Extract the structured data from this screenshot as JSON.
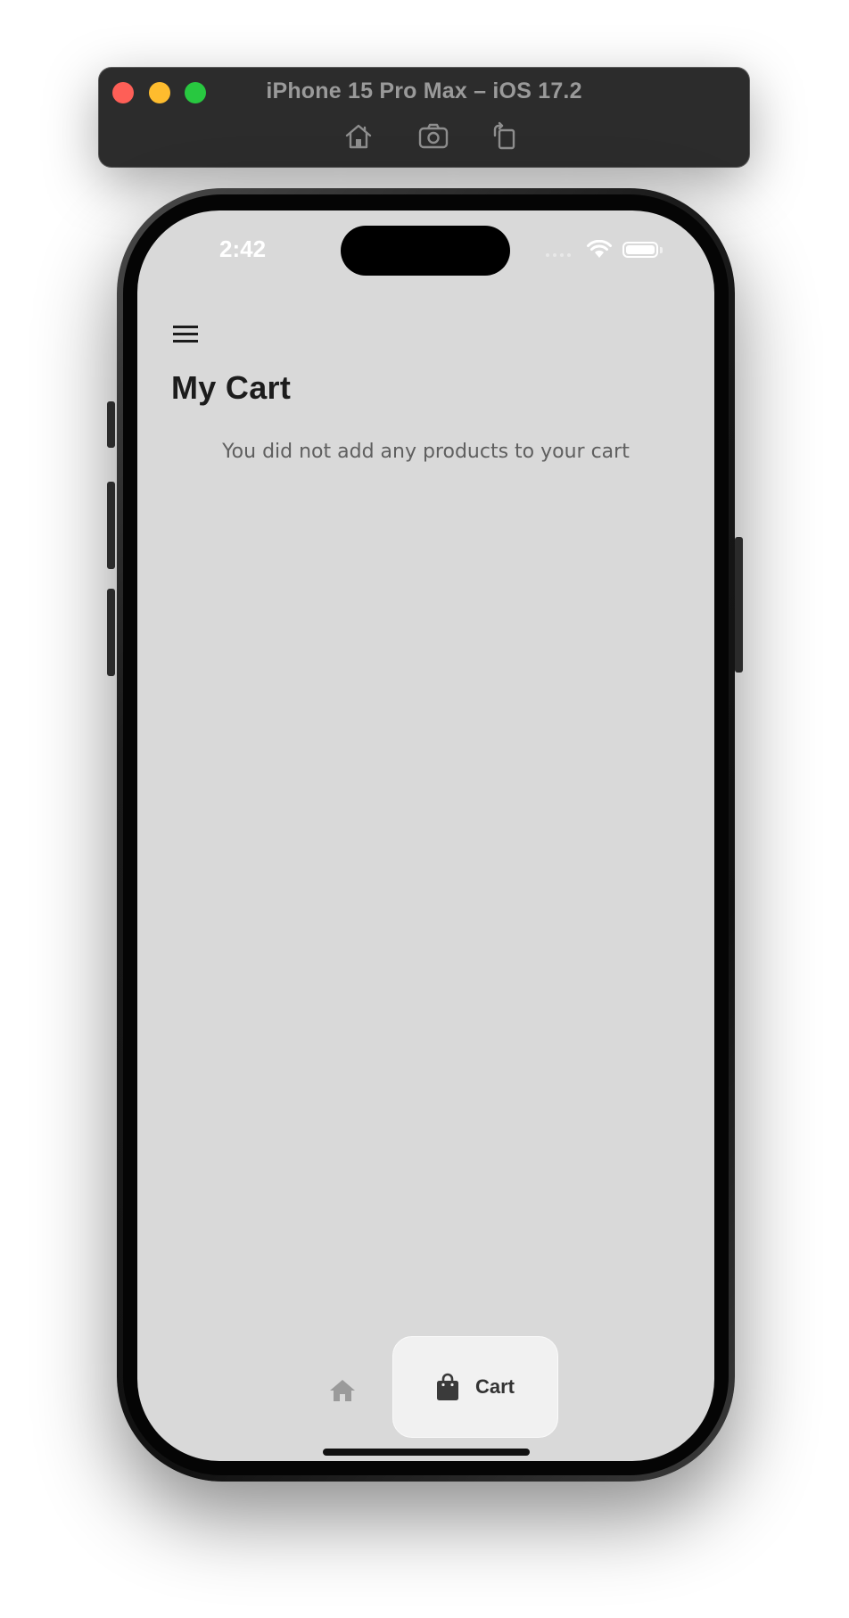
{
  "simulator": {
    "title": "iPhone 15 Pro Max – iOS 17.2",
    "toolbar": {
      "home_icon": "home-icon",
      "screenshot_icon": "camera-icon",
      "rotate_icon": "rotate-icon"
    }
  },
  "status_bar": {
    "time": "2:42"
  },
  "app": {
    "menu_icon": "hamburger-menu-icon",
    "title": "My Cart",
    "empty_message": "You did not add any products to your cart"
  },
  "bottom_nav": {
    "items": [
      {
        "icon": "home-icon",
        "label": "",
        "selected": false
      },
      {
        "icon": "shopping-bag-icon",
        "label": "Cart",
        "selected": true
      }
    ]
  },
  "colors": {
    "screen_background": "#d9d9d9",
    "title_text": "#1c1c1c",
    "body_text": "#5f5f5f",
    "nav_selected_background": "#f1f1f1",
    "simulator_bar": "#2c2c2c"
  }
}
